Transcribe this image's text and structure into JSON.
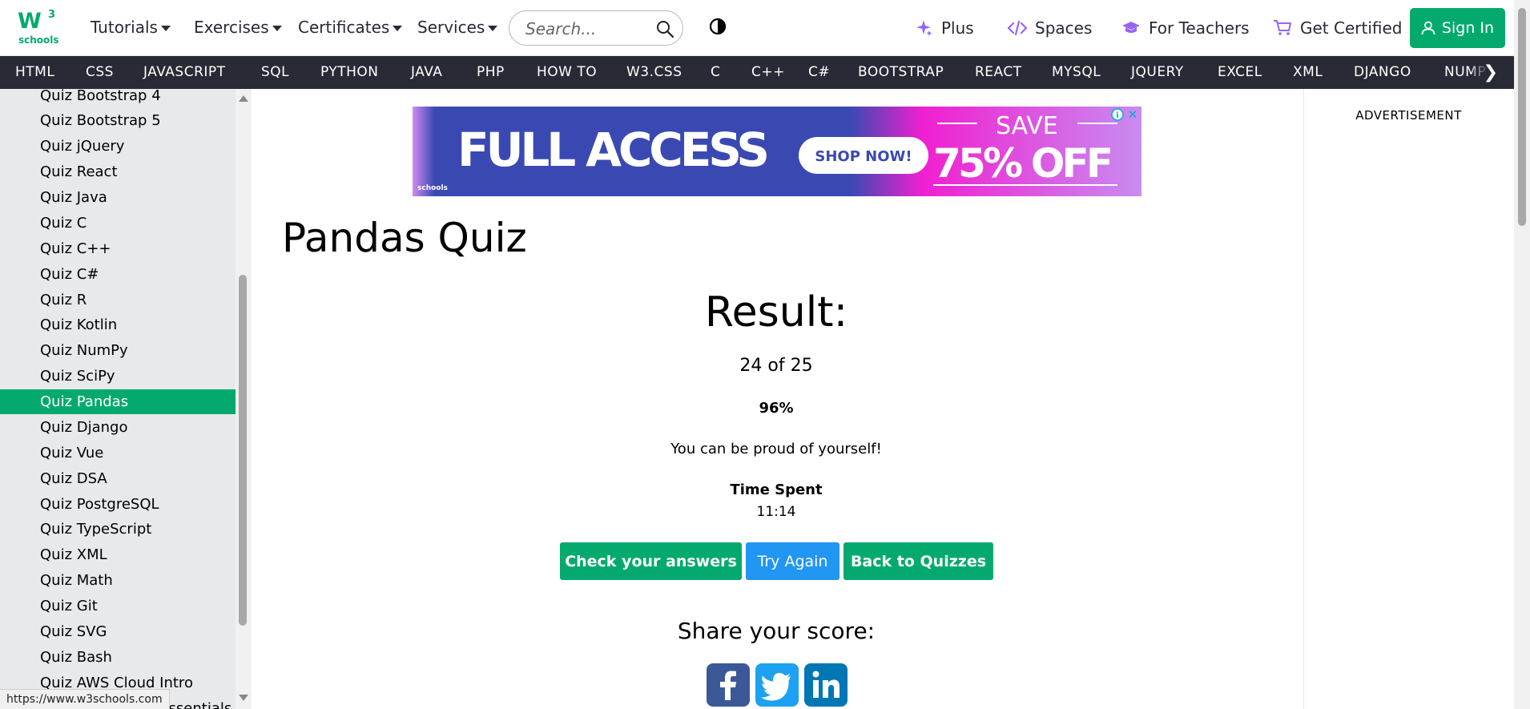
{
  "header": {
    "logo_text": "w3schools",
    "menus": [
      "Tutorials",
      "Exercises",
      "Certificates",
      "Services"
    ],
    "search_placeholder": "Search...",
    "right_links": [
      "Plus",
      "Spaces",
      "For Teachers",
      "Get Certified"
    ],
    "signin_label": "Sign In"
  },
  "subnav": {
    "items": [
      "HTML",
      "CSS",
      "JAVASCRIPT",
      "SQL",
      "PYTHON",
      "JAVA",
      "PHP",
      "HOW TO",
      "W3.CSS",
      "C",
      "C++",
      "C#",
      "BOOTSTRAP",
      "REACT",
      "MYSQL",
      "JQUERY",
      "EXCEL",
      "XML",
      "DJANGO",
      "NUMPY"
    ]
  },
  "sidebar": {
    "items": [
      "Quiz Bootstrap 4",
      "Quiz Bootstrap 5",
      "Quiz jQuery",
      "Quiz React",
      "Quiz Java",
      "Quiz C",
      "Quiz C++",
      "Quiz C#",
      "Quiz R",
      "Quiz Kotlin",
      "Quiz NumPy",
      "Quiz SciPy",
      "Quiz Pandas",
      "Quiz Django",
      "Quiz Vue",
      "Quiz DSA",
      "Quiz PostgreSQL",
      "Quiz TypeScript",
      "Quiz XML",
      "Quiz Math",
      "Quiz Git",
      "Quiz SVG",
      "Quiz Bash",
      "Quiz AWS Cloud Intro",
      "Quiz AWS Cloud Essentials"
    ],
    "active_index": 12
  },
  "ad": {
    "headline": "FULL ACCESS",
    "cta": "SHOP NOW!",
    "save_word": "SAVE",
    "discount": "75% OFF",
    "logo_text": "schools",
    "colors": {
      "left": "#3A49B2",
      "right": "#F020D0"
    }
  },
  "main": {
    "title": "Pandas Quiz",
    "result_heading": "Result:",
    "score": "24 of 25",
    "percent": "96%",
    "message": "You can be proud of yourself!",
    "time_label": "Time Spent",
    "time_value": "11:14",
    "buttons": {
      "check": "Check your answers",
      "retry": "Try Again",
      "back": "Back to Quizzes"
    },
    "share_heading": "Share your score:",
    "social_icons": [
      "facebook-icon",
      "twitter-icon",
      "linkedin-icon"
    ]
  },
  "right_column": {
    "ad_label": "ADVERTISEMENT"
  },
  "statusbar": {
    "url": "https://www.w3schools.com"
  },
  "colors": {
    "brand_green": "#04AA6D",
    "nav_dark": "#282A35",
    "sidebar_bg": "#E7E9EB",
    "blue_button": "#2196F3",
    "social_blue": "#3B5998"
  }
}
